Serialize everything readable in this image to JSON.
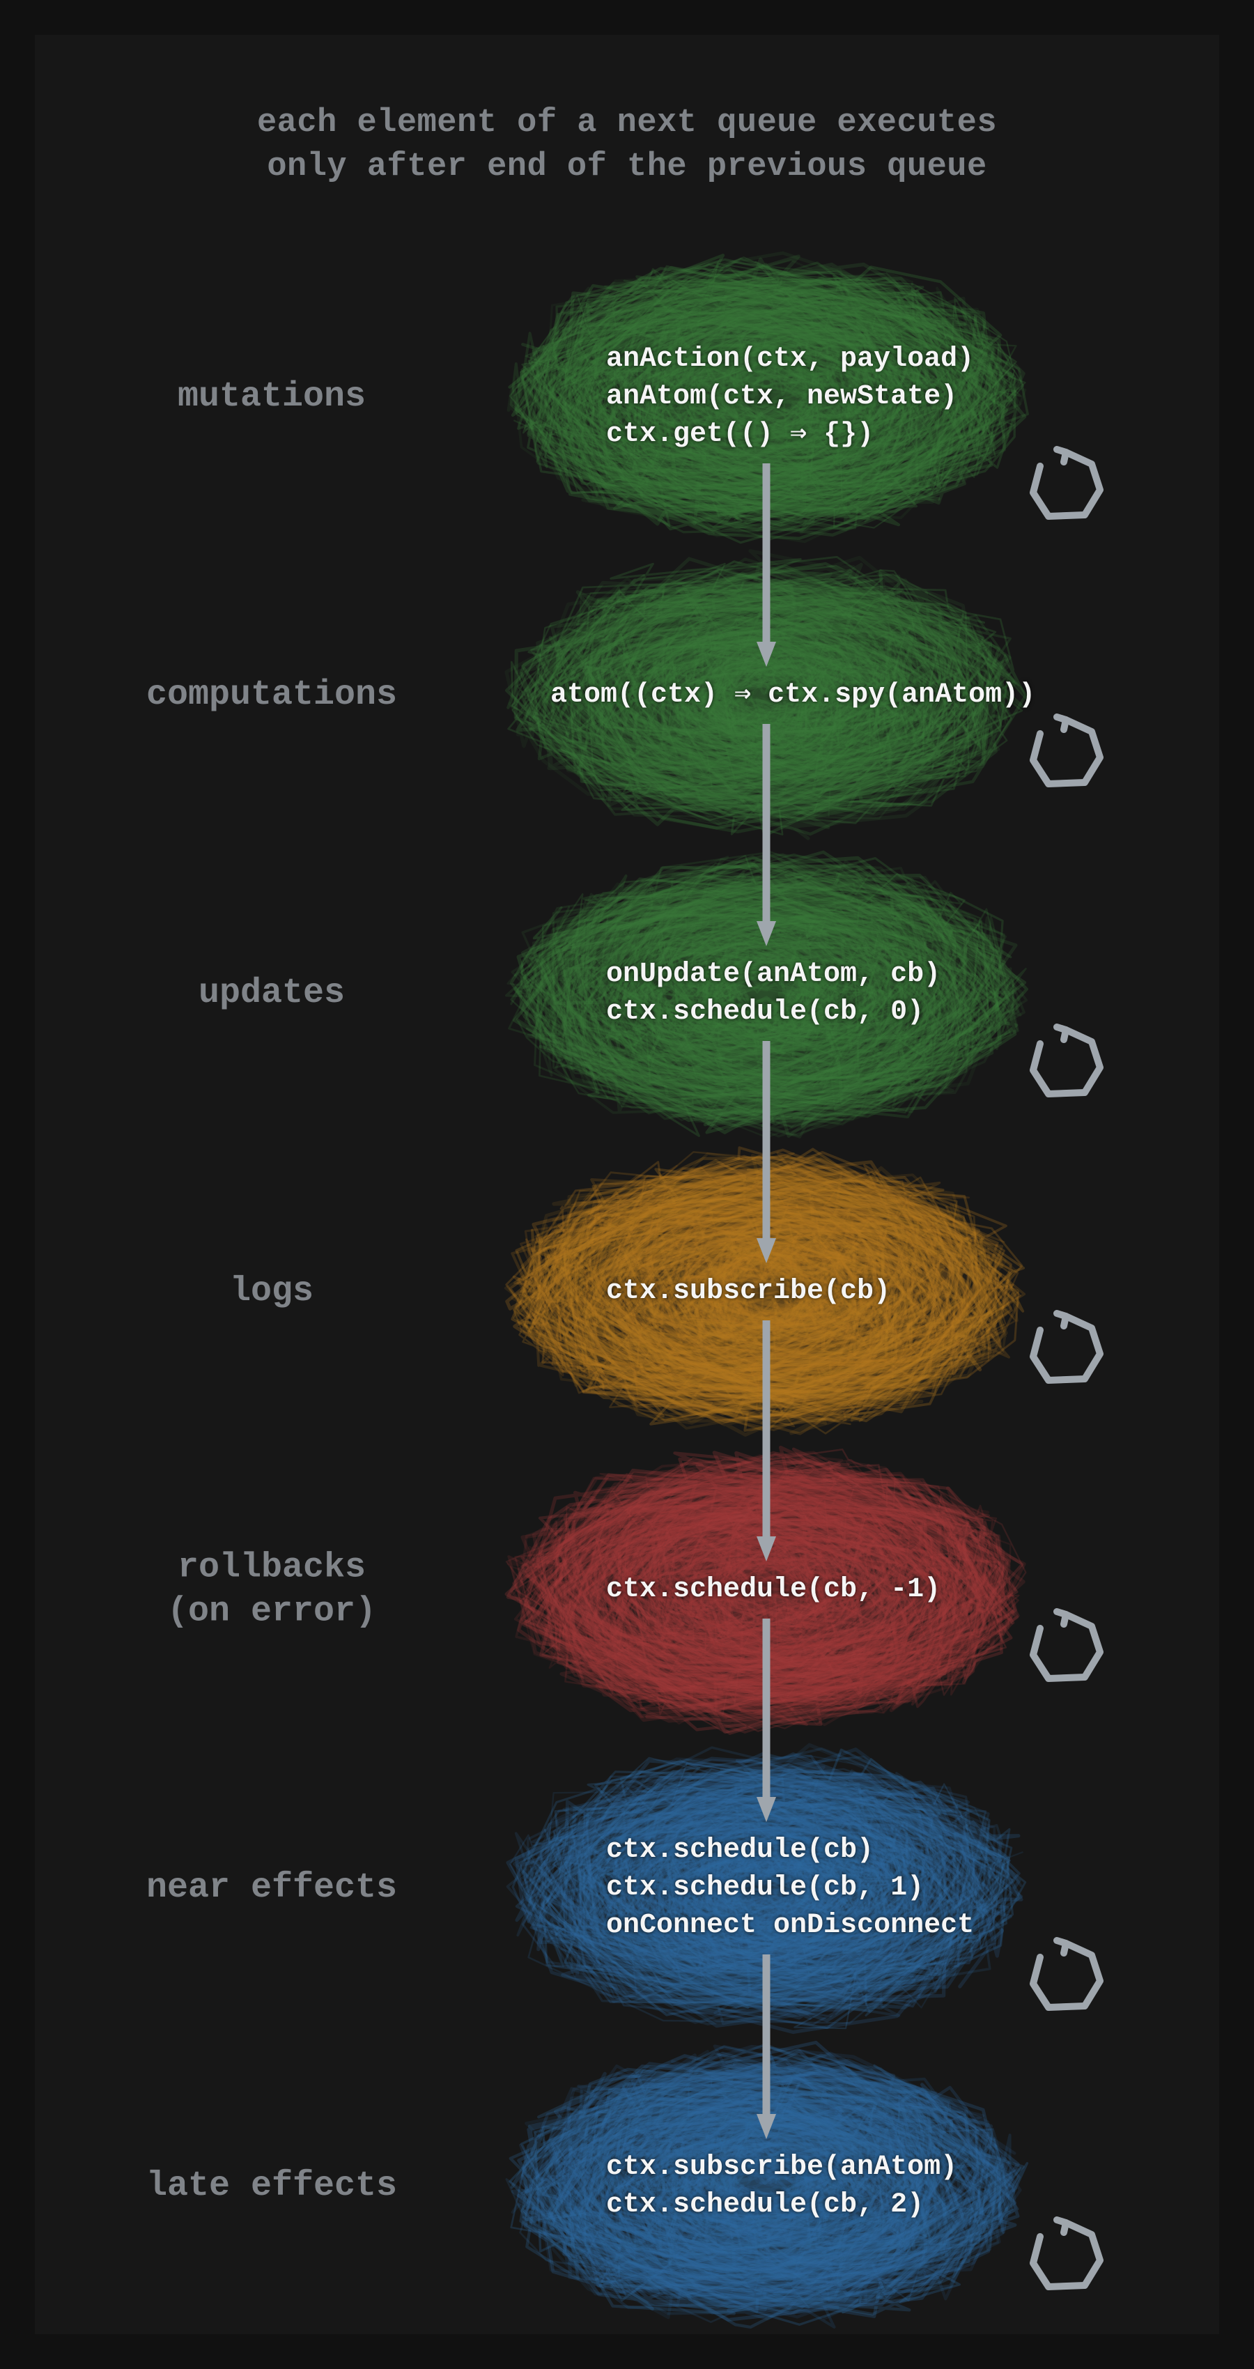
{
  "title": "each element of a next queue executes\nonly after end of the previous queue",
  "colors": {
    "green": "#3a7a3a",
    "orange": "#b5791f",
    "red": "#a33a3a",
    "blue": "#2f6aa0",
    "arrow": "#9fa6ad",
    "label": "#808489",
    "code": "#f5f5f5",
    "bg": "#171717"
  },
  "stages": [
    {
      "name": "mutations",
      "color": "green",
      "lines": [
        "anAction(ctx, payload)",
        "anAtom(ctx, newState)",
        "ctx.get(() ⇒ {})"
      ]
    },
    {
      "name": "computations",
      "color": "green",
      "lines": [
        "atom((ctx) ⇒ ctx.spy(anAtom))"
      ]
    },
    {
      "name": "updates",
      "color": "green",
      "lines": [
        "onUpdate(anAtom, cb)",
        "ctx.schedule(cb, 0)"
      ]
    },
    {
      "name": "logs",
      "color": "orange",
      "lines": [
        "ctx.subscribe(cb)"
      ]
    },
    {
      "name": "rollbacks\n(on error)",
      "color": "red",
      "lines": [
        "ctx.schedule(cb, -1)"
      ]
    },
    {
      "name": "near effects",
      "color": "blue",
      "lines": [
        "ctx.schedule(cb)",
        "ctx.schedule(cb, 1)",
        "onConnect onDisconnect"
      ]
    },
    {
      "name": "late effects",
      "color": "blue",
      "lines": [
        "ctx.subscribe(anAtom)",
        "ctx.schedule(cb, 2)"
      ]
    }
  ],
  "layout": {
    "startY": 310,
    "stepY": 428,
    "stageH": 420
  }
}
